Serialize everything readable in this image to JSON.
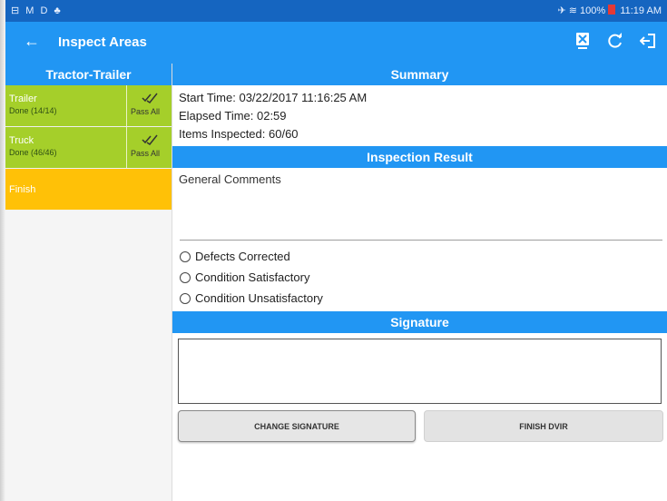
{
  "statusbar": {
    "left": "⊟ M D  ♣",
    "right": "✈ ≋ 100%",
    "time": "11:19 AM"
  },
  "appbar": {
    "title": "Inspect Areas"
  },
  "sidebar": {
    "header": "Tractor-Trailer",
    "items": [
      {
        "name": "Trailer",
        "status": "Done (14/14)",
        "pass_label": "Pass All"
      },
      {
        "name": "Truck",
        "status": "Done (46/46)",
        "pass_label": "Pass All"
      }
    ],
    "finish_label": "Finish"
  },
  "summary": {
    "header": "Summary",
    "start_time": "Start Time: 03/22/2017 11:16:25 AM",
    "elapsed_time": "Elapsed Time: 02:59",
    "items_inspected": "Items Inspected: 60/60"
  },
  "inspection_result": {
    "header": "Inspection Result",
    "comments_label": "General Comments",
    "options": [
      "Defects Corrected",
      "Condition Satisfactory",
      "Condition Unsatisfactory"
    ]
  },
  "signature": {
    "header": "Signature",
    "change_button": "CHANGE SIGNATURE",
    "finish_button": "FINISH DVIR"
  },
  "colors": {
    "primary": "#2196f3",
    "statusbar": "#1565c0",
    "done_green": "#a5cf2a",
    "finish_amber": "#ffc107"
  },
  "icons": [
    "back-arrow-icon",
    "delete-doc-icon",
    "refresh-icon",
    "logout-icon",
    "double-check-icon"
  ]
}
